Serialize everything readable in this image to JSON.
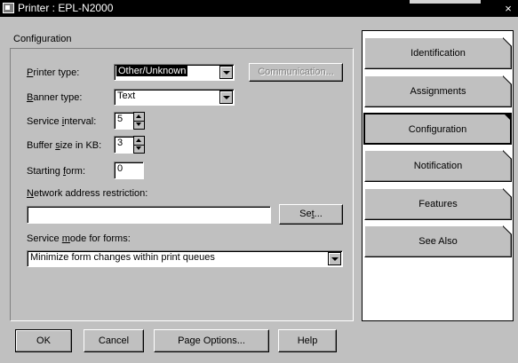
{
  "window": {
    "title": "Printer : EPL-N2000",
    "close_glyph": "×",
    "icon": "printer-icon"
  },
  "group": {
    "caption": "Configuration"
  },
  "form": {
    "printer_type_label": "Printer type:",
    "printer_type_value": "Other/Unknown",
    "communication_button": "Communication...",
    "banner_type_label": "Banner type:",
    "banner_type_value": "Text",
    "service_interval_label": "Service interval:",
    "service_interval_value": "5",
    "buffer_size_label": "Buffer size in KB:",
    "buffer_size_value": "3",
    "starting_form_label": "Starting form:",
    "starting_form_value": "0",
    "network_restriction_label": "Network address restriction:",
    "network_restriction_value": "",
    "set_button": "Set...",
    "service_mode_label": "Service mode for forms:",
    "service_mode_value": "Minimize form changes within print queues"
  },
  "buttons": {
    "ok": "OK",
    "cancel": "Cancel",
    "page_options": "Page Options...",
    "help": "Help"
  },
  "tabs": [
    {
      "label": "Identification",
      "active": false
    },
    {
      "label": "Assignments",
      "active": false
    },
    {
      "label": "Configuration",
      "active": true
    },
    {
      "label": "Notification",
      "active": false
    },
    {
      "label": "Features",
      "active": false
    },
    {
      "label": "See Also",
      "active": false
    }
  ],
  "colors": {
    "dialog_bg": "#c0c0c0",
    "titlebar_bg": "#000000",
    "selection_bg": "#000000",
    "disabled_text": "#808080"
  }
}
